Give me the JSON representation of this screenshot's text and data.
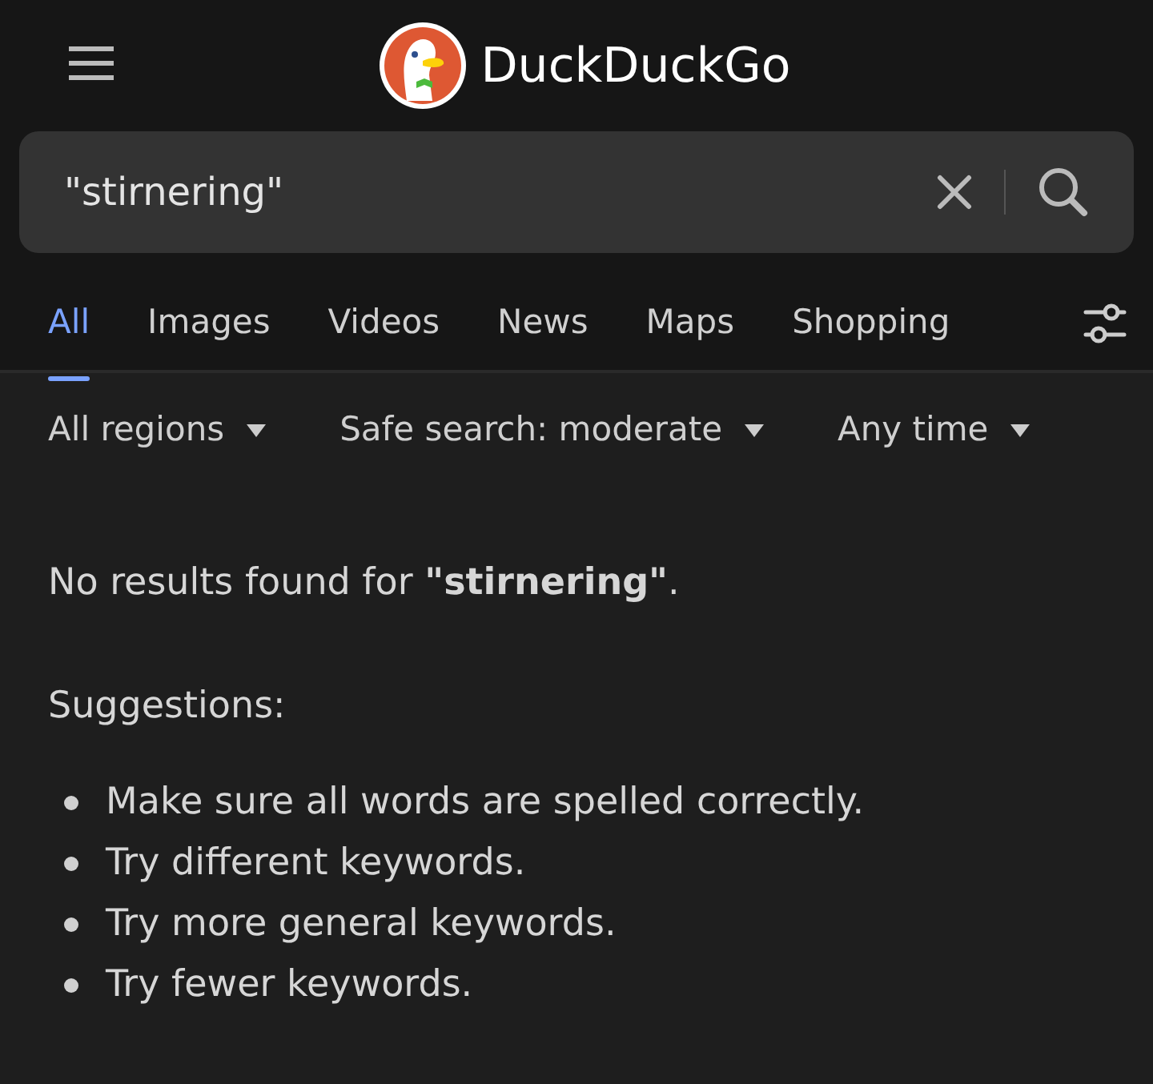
{
  "header": {
    "logo_text": "DuckDuckGo"
  },
  "search": {
    "value": "\"stirnering\""
  },
  "tabs": [
    {
      "label": "All",
      "selected": true
    },
    {
      "label": "Images",
      "selected": false
    },
    {
      "label": "Videos",
      "selected": false
    },
    {
      "label": "News",
      "selected": false
    },
    {
      "label": "Maps",
      "selected": false
    },
    {
      "label": "Shopping",
      "selected": false
    }
  ],
  "filters": [
    "All regions",
    "Safe search: moderate",
    "Any time"
  ],
  "message": "No results found for **\"stirnering\"**.",
  "suggestions_heading": "Suggestions:",
  "suggestions": [
    "Make sure all words are spelled correctly.",
    "Try different keywords.",
    "Try more general keywords.",
    "Try fewer keywords."
  ]
}
